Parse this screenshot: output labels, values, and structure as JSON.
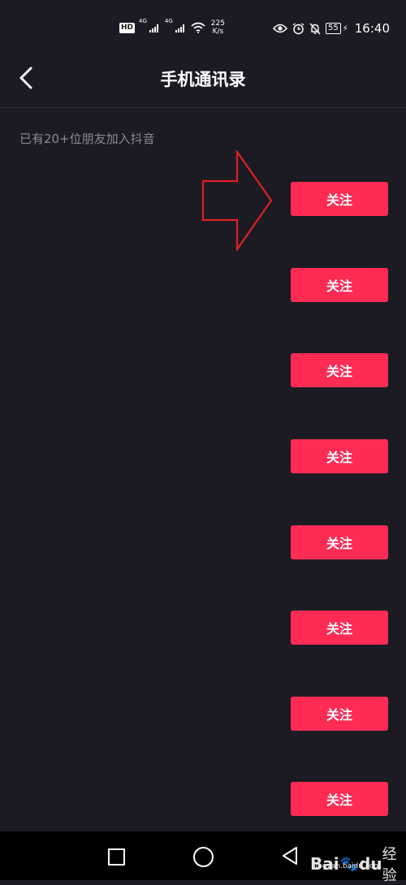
{
  "status_bar": {
    "hd": "HD",
    "net1": "4G",
    "net2": "4G",
    "speed_top": "225",
    "speed_bottom": "K/s",
    "battery": "55",
    "time": "16:40"
  },
  "header": {
    "title": "手机通讯录"
  },
  "subtitle": "已有20+位朋友加入抖音",
  "follow_buttons": [
    {
      "label": "关注"
    },
    {
      "label": "关注"
    },
    {
      "label": "关注"
    },
    {
      "label": "关注"
    },
    {
      "label": "关注"
    },
    {
      "label": "关注"
    },
    {
      "label": "关注"
    },
    {
      "label": "关注"
    }
  ],
  "annotation": {
    "arrow_color": "#e02020"
  },
  "colors": {
    "background": "#1c1b24",
    "accent": "#fe2c55"
  },
  "watermark": {
    "brand_a": "Bai",
    "brand_b": "du",
    "brand_cn": "经验",
    "url": "jingyan.baidu.com"
  },
  "icons": [
    "back-icon",
    "eye-icon",
    "alarm-icon",
    "mute-icon",
    "wifi-icon",
    "signal-icon",
    "battery-icon",
    "home-icon",
    "recent-apps-icon",
    "nav-back-icon"
  ]
}
